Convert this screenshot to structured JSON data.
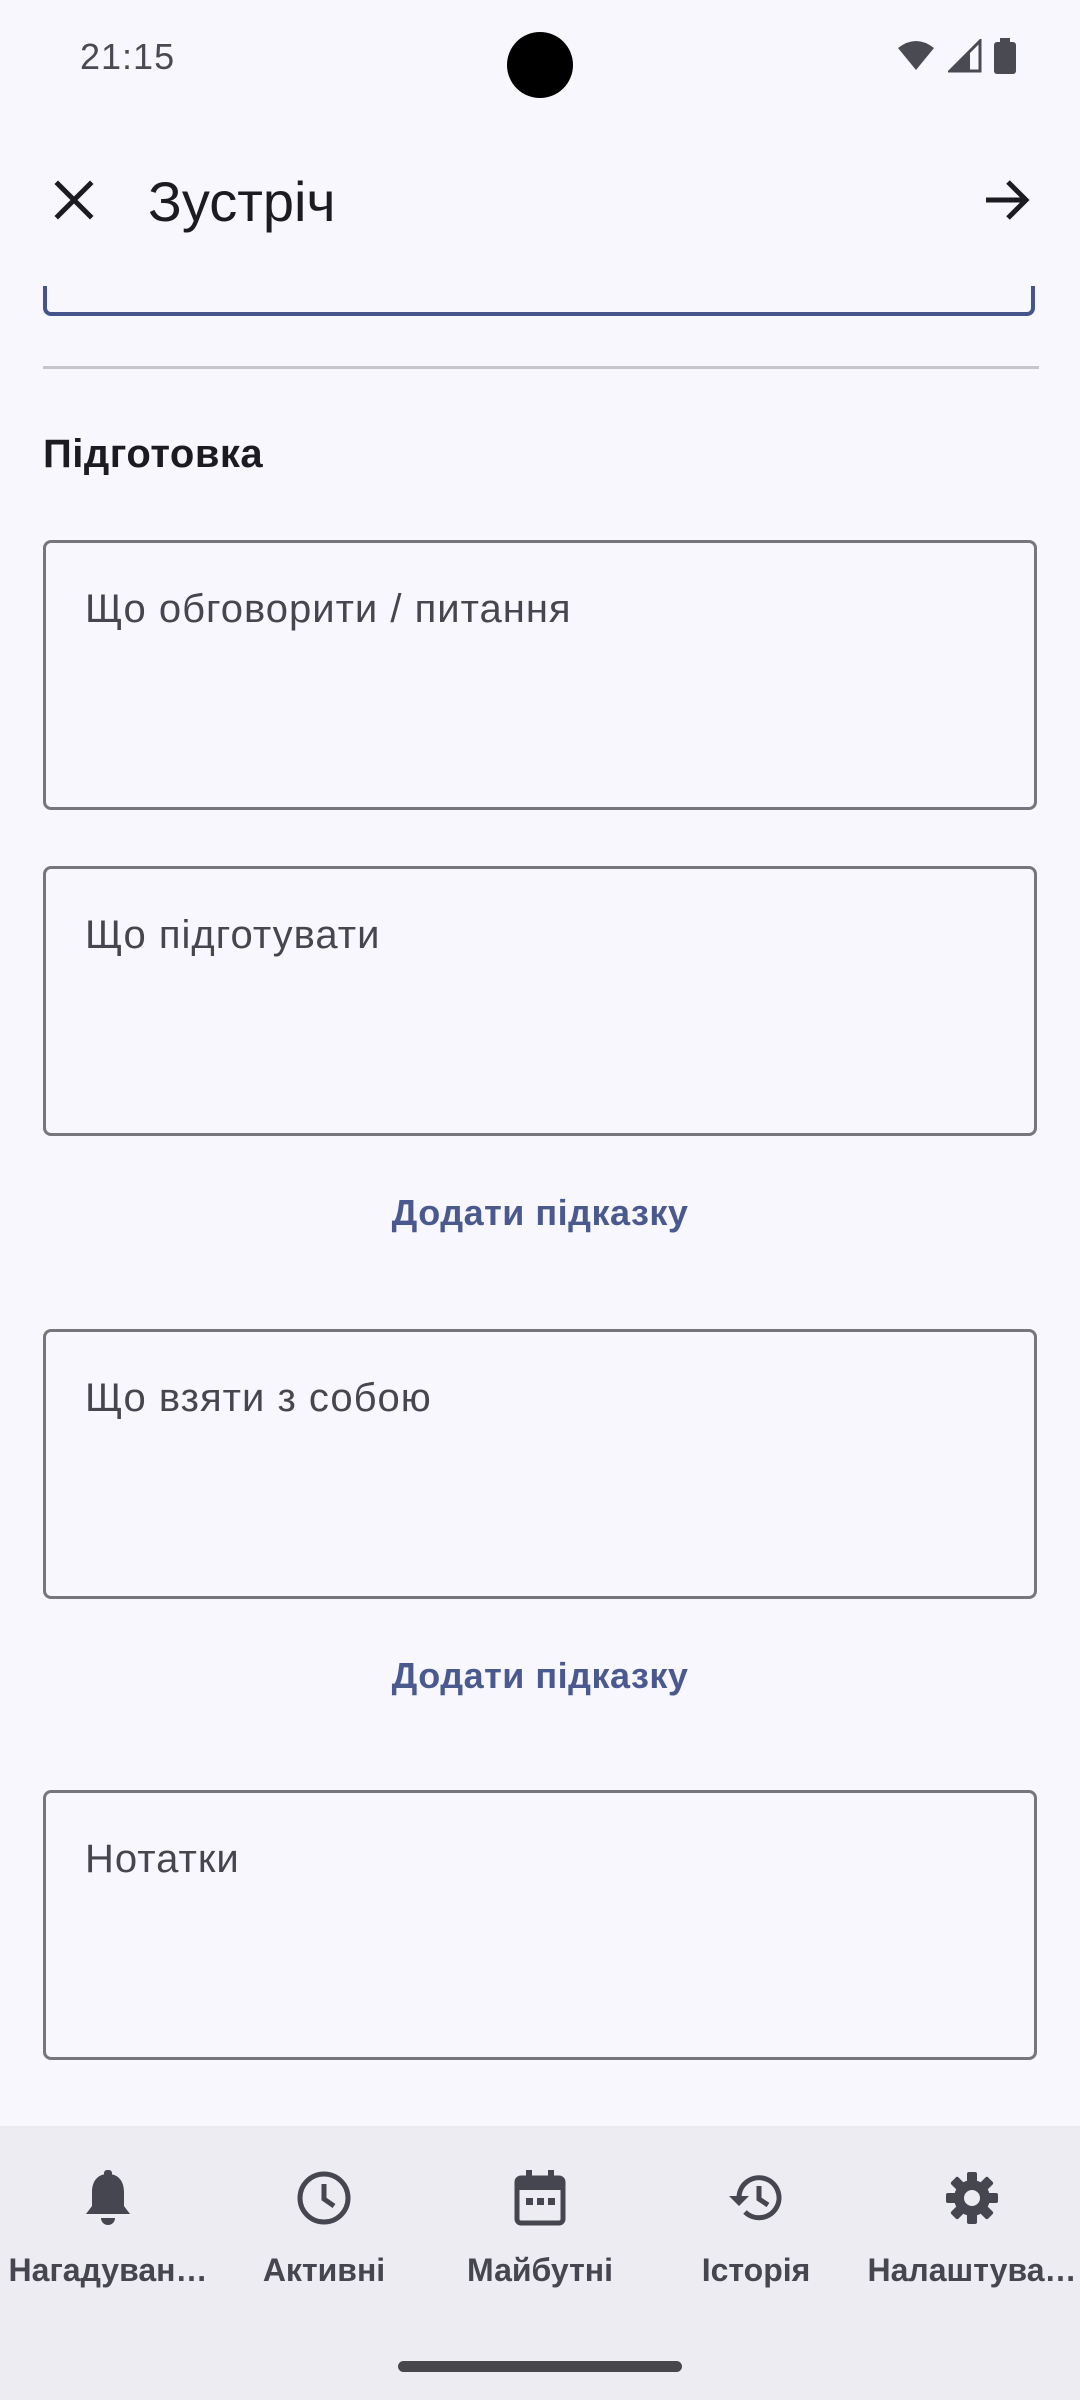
{
  "status_bar": {
    "time": "21:15",
    "icons": [
      "wifi-icon",
      "cell-signal-icon",
      "battery-icon"
    ]
  },
  "app_bar": {
    "close_icon": "close-icon",
    "title": "Зустріч",
    "next_icon": "arrow-forward-icon"
  },
  "form": {
    "section_title": "Підготовка",
    "fields": [
      {
        "placeholder": "Що обговорити / питання",
        "value": ""
      },
      {
        "placeholder": "Що підготувати",
        "value": ""
      },
      {
        "placeholder": "Що взяти з собою",
        "value": ""
      },
      {
        "placeholder": "Нотатки",
        "value": ""
      }
    ],
    "add_hint_label": "Додати підказку",
    "add_hint_label_2": "Додати підказку"
  },
  "bottom_nav": {
    "items": [
      {
        "label": "Нагадуван…",
        "icon": "bell-icon"
      },
      {
        "label": "Активні",
        "icon": "clock-icon"
      },
      {
        "label": "Майбутні",
        "icon": "calendar-icon"
      },
      {
        "label": "Історія",
        "icon": "history-icon"
      },
      {
        "label": "Налаштува…",
        "icon": "gear-icon"
      }
    ]
  },
  "colors": {
    "background": "#F8F7FD",
    "accent": "#45558B",
    "nav_background": "#EDECF2",
    "text_primary": "#1C1B20"
  }
}
